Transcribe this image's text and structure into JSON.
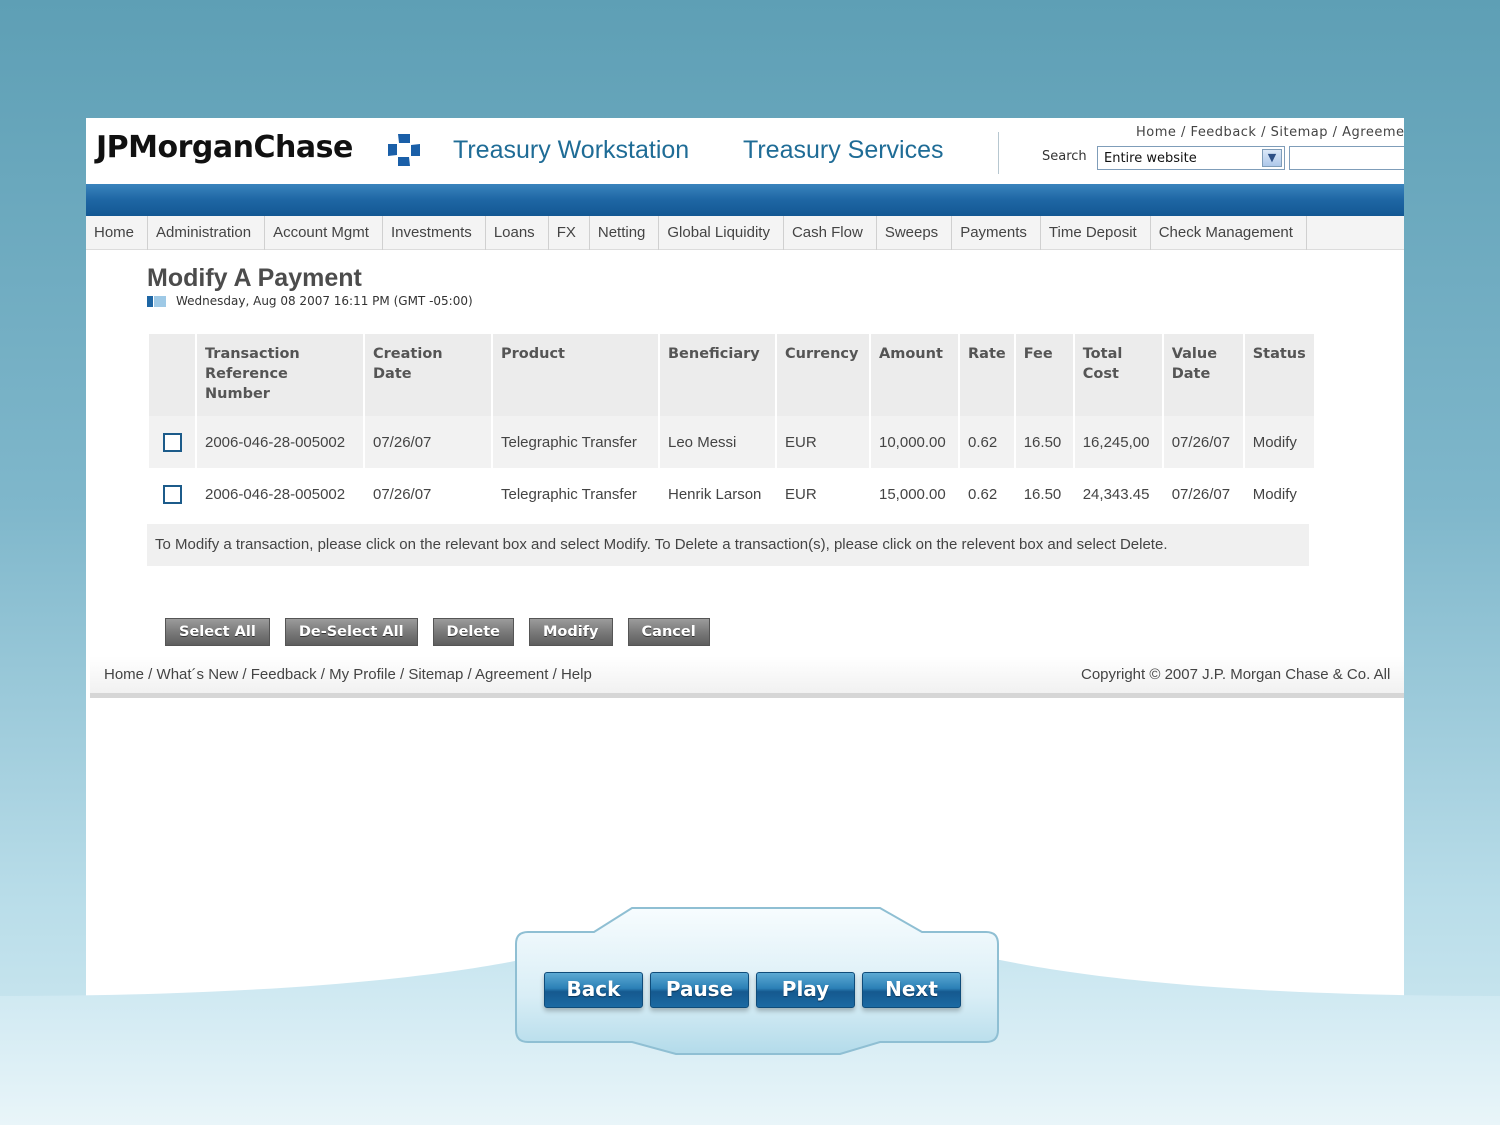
{
  "header": {
    "logo": "JPMorganChase",
    "app_title_1": "Treasury Workstation",
    "app_title_2": "Treasury Services",
    "top_links": [
      "Home",
      "Feedback",
      "Sitemap",
      "Agreement"
    ],
    "search_label": "Search",
    "search_scope": "Entire website",
    "search_value": ""
  },
  "nav": {
    "items": [
      "Home",
      "Administration",
      "Account Mgmt",
      "Investments",
      "Loans",
      "FX",
      "Netting",
      "Global Liquidity",
      "Cash Flow",
      "Sweeps",
      "Payments",
      "Time Deposit",
      "Check Management"
    ]
  },
  "page": {
    "title": "Modify A Payment",
    "datetime": "Wednesday, Aug 08 2007 16:11 PM (GMT -05:00)"
  },
  "table": {
    "headers": [
      "",
      "Transaction Reference Number",
      "Creation Date",
      "Product",
      "Beneficiary",
      "Currency",
      "Amount",
      "Rate",
      "Fee",
      "Total Cost",
      "Value Date",
      "Status"
    ],
    "rows": [
      {
        "ref": "2006-046-28-005002",
        "created": "07/26/07",
        "product": "Telegraphic Transfer",
        "beneficiary": "Leo Messi",
        "currency": "EUR",
        "amount": "10,000.00",
        "rate": "0.62",
        "fee": "16.50",
        "total": "16,245,00",
        "value_date": "07/26/07",
        "status": "Modify"
      },
      {
        "ref": "2006-046-28-005002",
        "created": "07/26/07",
        "product": "Telegraphic Transfer",
        "beneficiary": "Henrik Larson",
        "currency": "EUR",
        "amount": "15,000.00",
        "rate": "0.62",
        "fee": "16.50",
        "total": "24,343.45",
        "value_date": "07/26/07",
        "status": "Modify"
      }
    ],
    "note": "To Modify a transaction, please click on the relevant box and select Modify. To Delete a transaction(s), please click on the relevent box and select Delete."
  },
  "actions": {
    "select_all": "Select All",
    "deselect_all": "De-Select All",
    "delete": "Delete",
    "modify": "Modify",
    "cancel": "Cancel"
  },
  "footer": {
    "links": [
      "Home",
      "What´s New",
      "Feedback",
      "My Profile",
      "Sitemap",
      "Agreement",
      "Help"
    ],
    "copyright": "Copyright © 2007 J.P. Morgan Chase & Co. All"
  },
  "player": {
    "back": "Back",
    "pause": "Pause",
    "play": "Play",
    "next": "Next"
  },
  "colors": {
    "brand_blue": "#1f6c96",
    "band_blue": "#1e66a4",
    "button_gray": "#7a7a7a",
    "player_blue": "#2b80b6"
  }
}
